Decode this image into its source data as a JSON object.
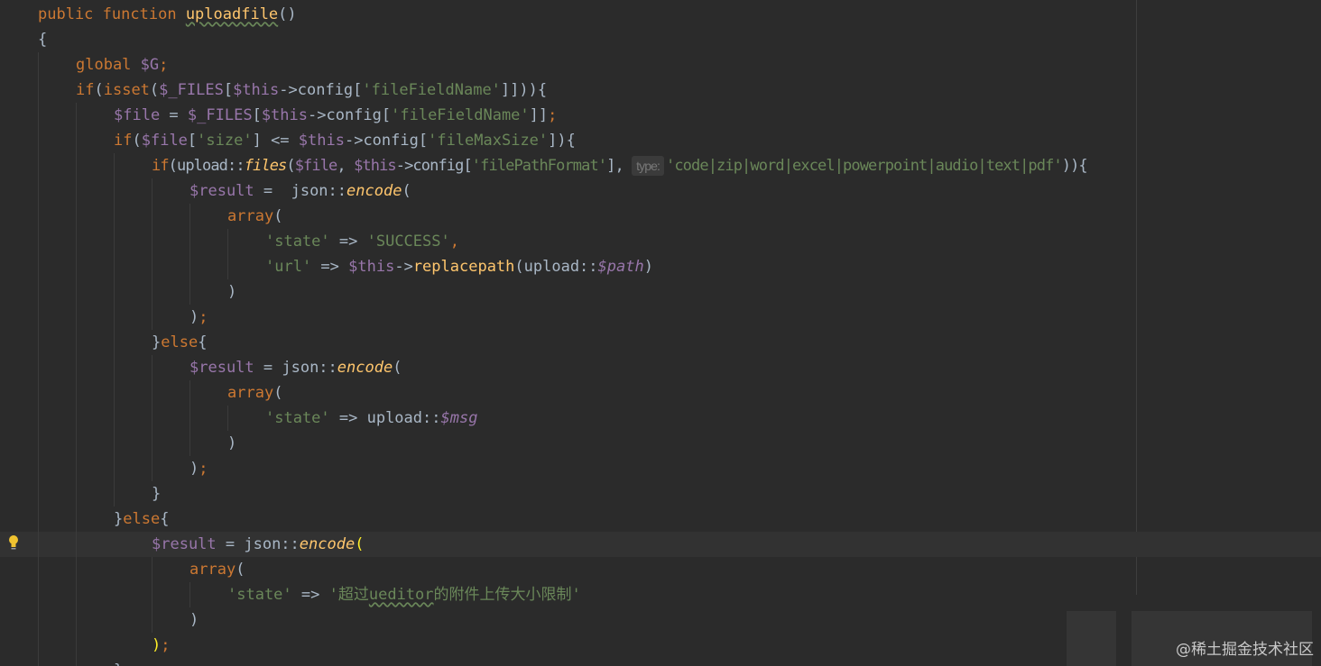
{
  "code": {
    "l1": {
      "kw1": "public",
      "kw2": "function",
      "name": "uploadfile",
      "rest": "()"
    },
    "l2": {
      "text": "{"
    },
    "l3": {
      "kw": "global",
      "var": "$G",
      "semi": ";"
    },
    "l4": {
      "kw": "if",
      "p1": "(",
      "fn": "isset",
      "p2": "(",
      "var1": "$_FILES",
      "p3": "[",
      "var2": "$this",
      "p4": "->config[",
      "str": "'fileFieldName'",
      "p5": "]])){"
    },
    "l5": {
      "var1": "$file",
      "op": " = ",
      "var2": "$_FILES",
      "p1": "[",
      "var3": "$this",
      "p2": "->config[",
      "str": "'fileFieldName'",
      "p3": "]]",
      "semi": ";"
    },
    "l6": {
      "kw": "if",
      "p1": "(",
      "var1": "$file",
      "p2": "[",
      "str1": "'size'",
      "p3": "] <= ",
      "var2": "$this",
      "p4": "->config[",
      "str2": "'fileMaxSize'",
      "p5": "]){"
    },
    "l7": {
      "kw": "if",
      "p1": "(upload::",
      "fn": "files",
      "p2": "(",
      "var1": "$file",
      "comma": ", ",
      "var2": "$this",
      "p3": "->config[",
      "str1": "'filePathFormat'",
      "p4": "], ",
      "hint": "type:",
      "str2": "'code|zip|word|excel|powerpoint|audio|text|pdf'",
      "p5": ")){"
    },
    "l8": {
      "var": "$result",
      "op": " =  json::",
      "fn": "encode",
      "p": "("
    },
    "l9": {
      "kw": "array",
      "p": "("
    },
    "l10": {
      "str1": "'state'",
      "op": " => ",
      "str2": "'SUCCESS'",
      "comma": ","
    },
    "l11": {
      "str": "'url'",
      "op": " => ",
      "var": "$this",
      "p1": "->",
      "fn": "replacepath",
      "p2": "(upload::",
      "var2": "$path",
      "p3": ")"
    },
    "l12": {
      "text": ")"
    },
    "l13": {
      "p": ")",
      "semi": ";"
    },
    "l14": {
      "p1": "}",
      "kw": "else",
      "p2": "{"
    },
    "l15": {
      "var": "$result",
      "op": " = json::",
      "fn": "encode",
      "p": "("
    },
    "l16": {
      "kw": "array",
      "p": "("
    },
    "l17": {
      "str": "'state'",
      "op": " => upload::",
      "var": "$msg"
    },
    "l18": {
      "text": ")"
    },
    "l19": {
      "p": ")",
      "semi": ";"
    },
    "l20": {
      "text": "}"
    },
    "l21": {
      "p1": "}",
      "kw": "else",
      "p2": "{"
    },
    "l22": {
      "var": "$result",
      "op": " = json::",
      "fn": "encode",
      "p": "("
    },
    "l23": {
      "kw": "array",
      "p": "("
    },
    "l24": {
      "str1": "'state'",
      "op": " => ",
      "str2a": "'超过",
      "str2b": "ueditor",
      "str2c": "的附件上传大小限制'"
    },
    "l25": {
      "text": ")"
    },
    "l26": {
      "p": ")",
      "semi": ";"
    },
    "l27": {
      "text": "}"
    }
  },
  "watermark": "@稀土掘金技术社区",
  "colors": {
    "background": "#2b2b2b",
    "current_line": "#323232",
    "keyword": "#cc7832",
    "function": "#ffc66d",
    "variable": "#9876aa",
    "string": "#6a8759",
    "default": "#a9b7c6"
  },
  "icons": {
    "gutter": "lightbulb-icon"
  }
}
